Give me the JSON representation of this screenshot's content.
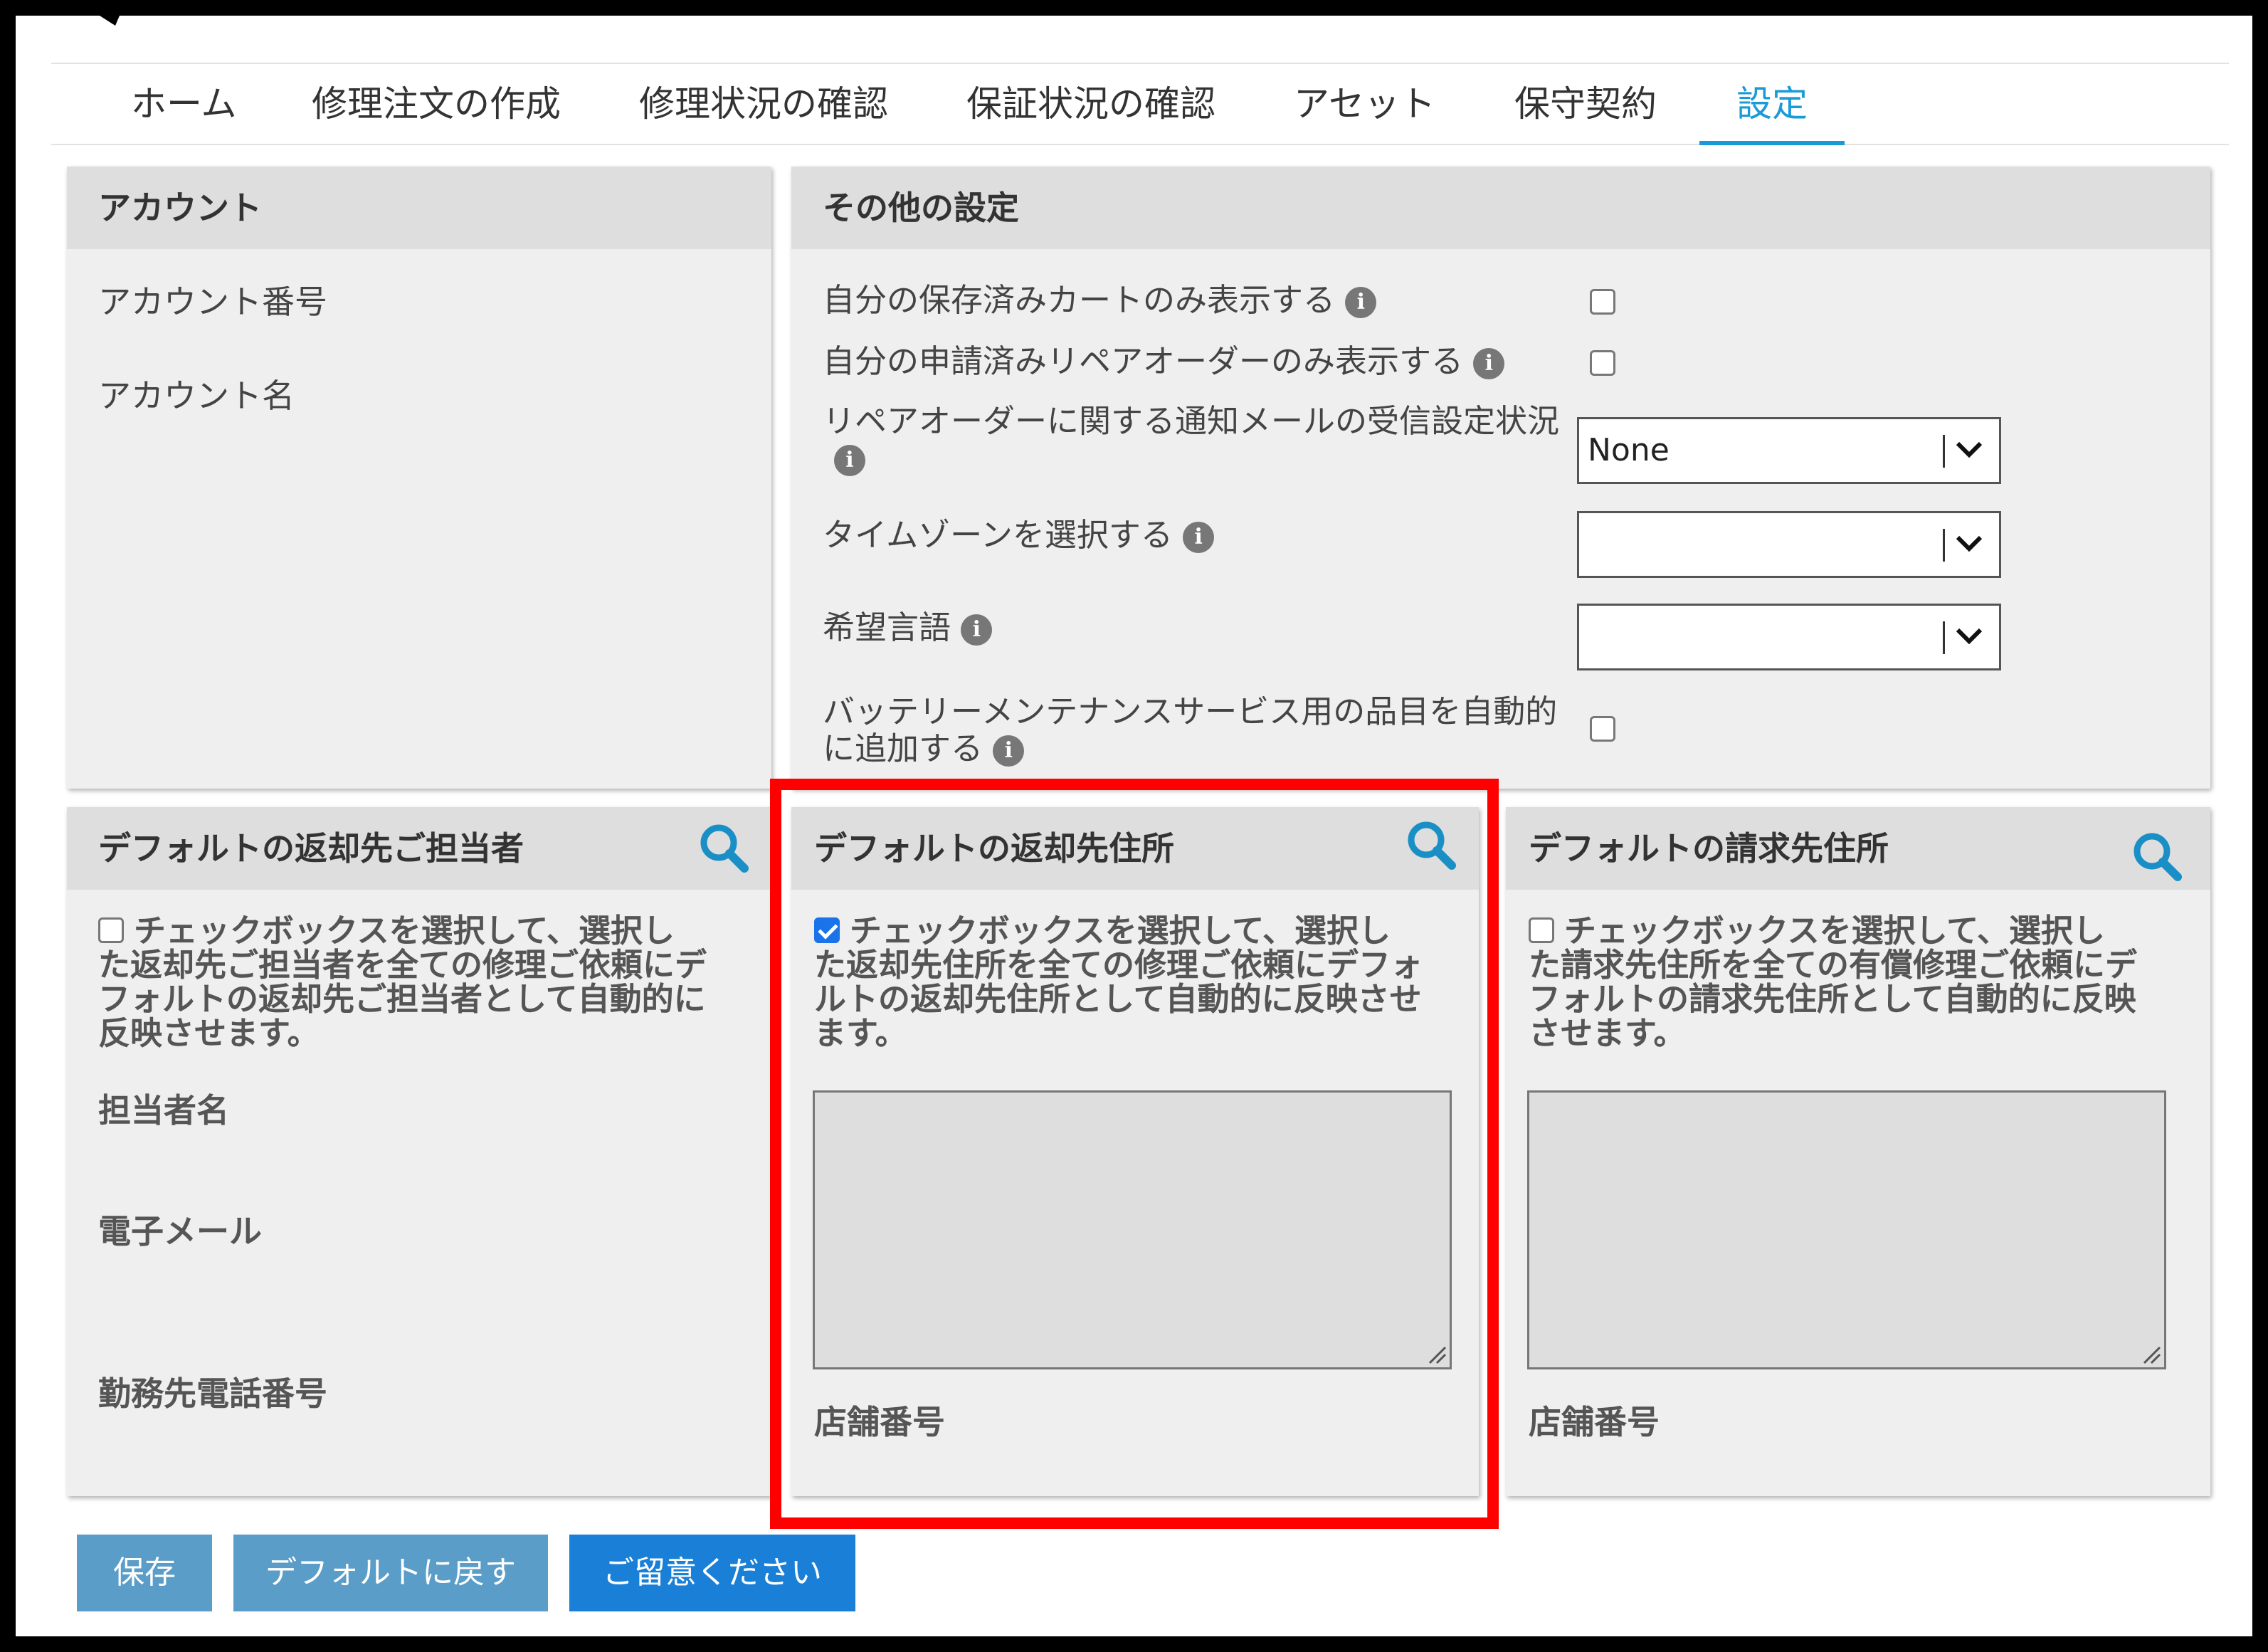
{
  "nav": {
    "tabs": [
      {
        "label": "ホーム"
      },
      {
        "label": "修理注文の作成"
      },
      {
        "label": "修理状況の確認"
      },
      {
        "label": "保証状況の確認"
      },
      {
        "label": "アセット"
      },
      {
        "label": "保守契約"
      },
      {
        "label": "設定",
        "active": true
      }
    ]
  },
  "account": {
    "title": "アカウント",
    "number_label": "アカウント番号",
    "name_label": "アカウント名"
  },
  "other_settings": {
    "title": "その他の設定",
    "rows": [
      {
        "label": "自分の保存済みカートのみ表示する",
        "control": "checkbox",
        "checked": false
      },
      {
        "label": "自分の申請済みリペアオーダーのみ表示する",
        "control": "checkbox",
        "checked": false
      },
      {
        "label": "リペアオーダーに関する通知メールの受信設定状況",
        "control": "select",
        "value": "None"
      },
      {
        "label": "タイムゾーンを選択する",
        "control": "select",
        "value": ""
      },
      {
        "label": "希望言語",
        "control": "select",
        "value": ""
      },
      {
        "label_line1": "バッテリーメンテナンスサービス用の品目を自動的",
        "label_line2": "に追加する",
        "control": "checkbox",
        "checked": false
      }
    ]
  },
  "return_contact": {
    "title": "デフォルトの返却先ご担当者",
    "checked": false,
    "desc_lines": [
      "チェックボックスを選択して、選択し",
      "た返却先ご担当者を全ての修理ご依頼にデ",
      "フォルトの返却先ご担当者として自動的に",
      "反映させます。"
    ],
    "contact_name_label": "担当者名",
    "email_label": "電子メール",
    "phone_label": "勤務先電話番号"
  },
  "return_address": {
    "title": "デフォルトの返却先住所",
    "checked": true,
    "desc_lines": [
      "チェックボックスを選択して、選択し",
      "た返却先住所を全ての修理ご依頼にデフォ",
      "ルトの返却先住所として自動的に反映させ",
      "ます。"
    ],
    "store_label": "店舗番号"
  },
  "billing_address": {
    "title": "デフォルトの請求先住所",
    "checked": false,
    "desc_lines": [
      "チェックボックスを選択して、選択し",
      "た請求先住所を全ての有償修理ご依頼にデ",
      "フォルトの請求先住所として自動的に反映",
      "させます。"
    ],
    "store_label": "店舗番号"
  },
  "buttons": {
    "save": "保存",
    "reset": "デフォルトに戻す",
    "notice": "ご留意ください"
  },
  "colors": {
    "accent": "#1a9ad6",
    "highlight": "#ff0000",
    "button_muted": "#5b9dc9",
    "button_primary": "#1a7fd6"
  }
}
